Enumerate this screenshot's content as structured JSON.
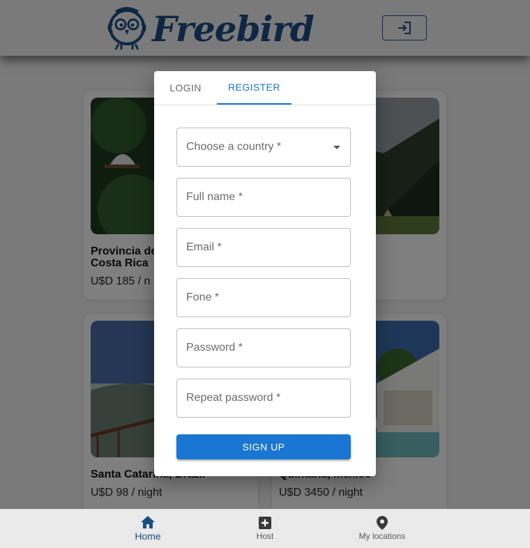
{
  "header": {
    "brand": "Freebird",
    "brand_color": "#1a4f86",
    "login_icon": "login-icon"
  },
  "listings": [
    {
      "title_line1": "Provincia de",
      "title_line2": "Costa Rica",
      "price": "U$D 185 / n"
    },
    {
      "title_line1": "",
      "title_line2": "",
      "price": ""
    },
    {
      "title_line1": "Santa Catarina, Brazil",
      "title_line2": "",
      "price": "U$D 98 / night"
    },
    {
      "title_line1": "Quintana, Mexico",
      "title_line2": "",
      "price": "U$D 3450 / night"
    }
  ],
  "modal": {
    "tabs": [
      {
        "label": "LOGIN",
        "active": false
      },
      {
        "label": "REGISTER",
        "active": true
      }
    ],
    "fields": [
      {
        "label": "Choose a country *",
        "type": "select"
      },
      {
        "label": "Full name *",
        "type": "text"
      },
      {
        "label": "Email *",
        "type": "email"
      },
      {
        "label": "Fone *",
        "type": "tel"
      },
      {
        "label": "Password *",
        "type": "password"
      },
      {
        "label": "Repeat password *",
        "type": "password"
      }
    ],
    "submit_label": "SIGN UP",
    "accent": "#1976d2"
  },
  "bottom_nav": [
    {
      "label": "Home",
      "icon": "home-icon",
      "active": true
    },
    {
      "label": "Host",
      "icon": "add-box-icon",
      "active": false
    },
    {
      "label": "My locations",
      "icon": "location-pin-icon",
      "active": false
    }
  ]
}
